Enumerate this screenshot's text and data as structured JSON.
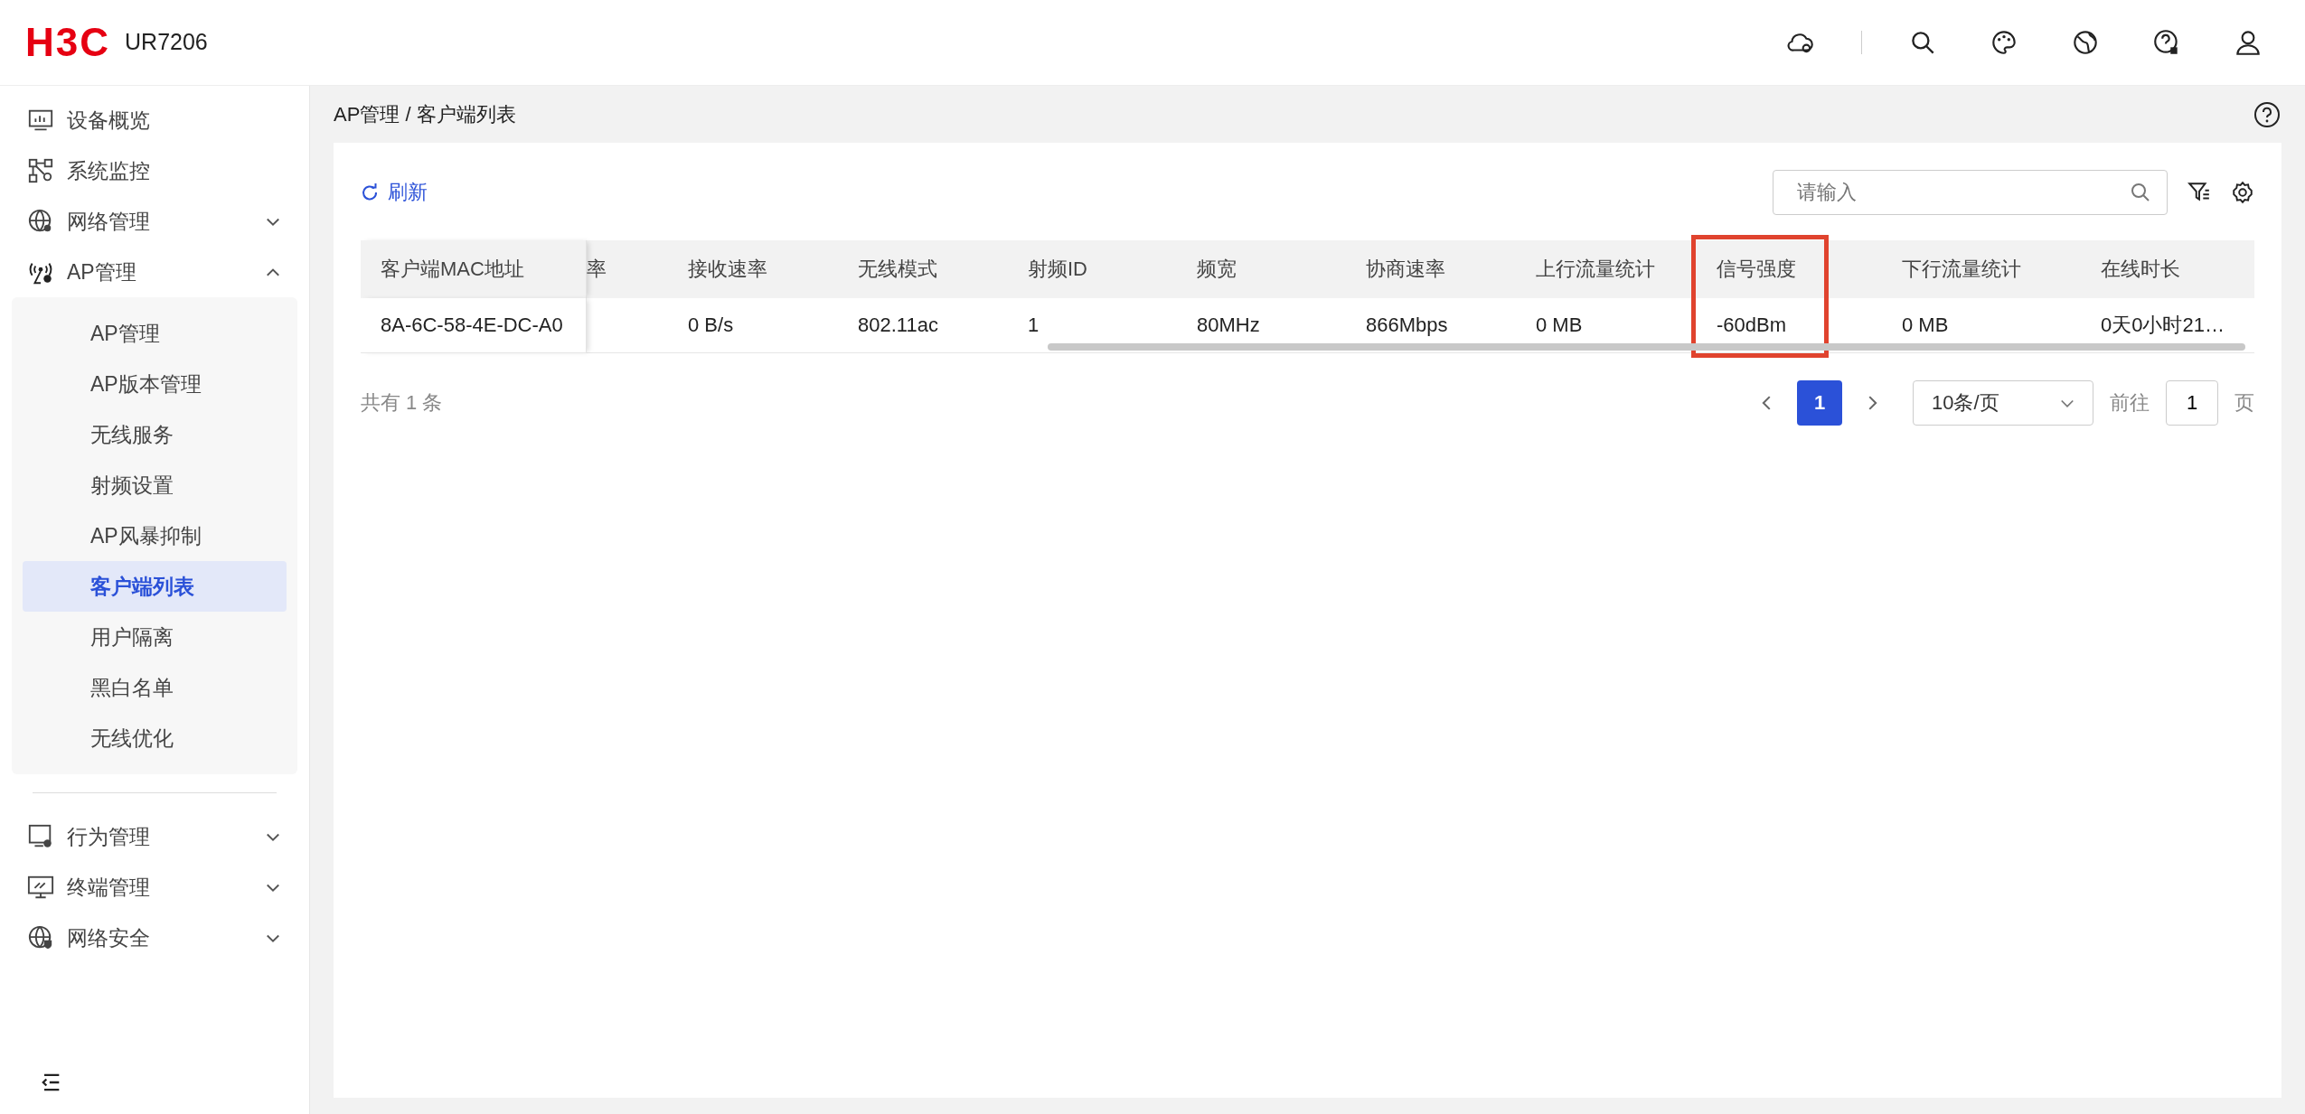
{
  "header": {
    "logo": "H3C",
    "model": "UR7206"
  },
  "sidebar": {
    "items": [
      {
        "label": "设备概览",
        "selected": false
      },
      {
        "label": "系统监控",
        "selected": false
      },
      {
        "label": "网络管理",
        "selected": false,
        "expanded": false
      },
      {
        "label": "AP管理",
        "selected": false,
        "expanded": true,
        "children": [
          {
            "label": "AP管理",
            "selected": false
          },
          {
            "label": "AP版本管理",
            "selected": false
          },
          {
            "label": "无线服务",
            "selected": false
          },
          {
            "label": "射频设置",
            "selected": false
          },
          {
            "label": "AP风暴抑制",
            "selected": false
          },
          {
            "label": "客户端列表",
            "selected": true
          },
          {
            "label": "用户隔离",
            "selected": false
          },
          {
            "label": "黑白名单",
            "selected": false
          },
          {
            "label": "无线优化",
            "selected": false
          }
        ]
      },
      {
        "label": "行为管理",
        "selected": false,
        "expanded": false
      },
      {
        "label": "终端管理",
        "selected": false,
        "expanded": false
      },
      {
        "label": "网络安全",
        "selected": false,
        "expanded": false
      }
    ]
  },
  "breadcrumb": "AP管理 / 客户端列表",
  "toolbar": {
    "refresh": "刷新",
    "search": {
      "placeholder": "请输入"
    }
  },
  "table": {
    "columns": [
      {
        "header": "客户端MAC地址",
        "pinned": true,
        "highlighted": false
      },
      {
        "header": "率",
        "pinned": false,
        "highlighted": false
      },
      {
        "header": "接收速率",
        "pinned": false,
        "highlighted": false
      },
      {
        "header": "无线模式",
        "pinned": false,
        "highlighted": false
      },
      {
        "header": "射频ID",
        "pinned": false,
        "highlighted": false
      },
      {
        "header": "频宽",
        "pinned": false,
        "highlighted": false
      },
      {
        "header": "协商速率",
        "pinned": false,
        "highlighted": false
      },
      {
        "header": "上行流量统计",
        "pinned": false,
        "highlighted": false
      },
      {
        "header": "信号强度",
        "pinned": false,
        "highlighted": true
      },
      {
        "header": "下行流量统计",
        "pinned": false,
        "highlighted": false
      },
      {
        "header": "在线时长",
        "pinned": false,
        "highlighted": false
      }
    ],
    "rows": [
      {
        "cells": [
          "8A-6C-58-4E-DC-A0",
          "",
          "0 B/s",
          "802.11ac",
          "1",
          "80MHz",
          "866Mbps",
          "0 MB",
          "-60dBm",
          "0 MB",
          "0天0小时21…"
        ]
      }
    ]
  },
  "pagination": {
    "total": "共有 1 条",
    "pages": [
      {
        "label": "1",
        "selected": true
      }
    ],
    "page_size": "10条/页",
    "goto_label": "前往",
    "goto_value": "1",
    "page_suffix": "页"
  }
}
